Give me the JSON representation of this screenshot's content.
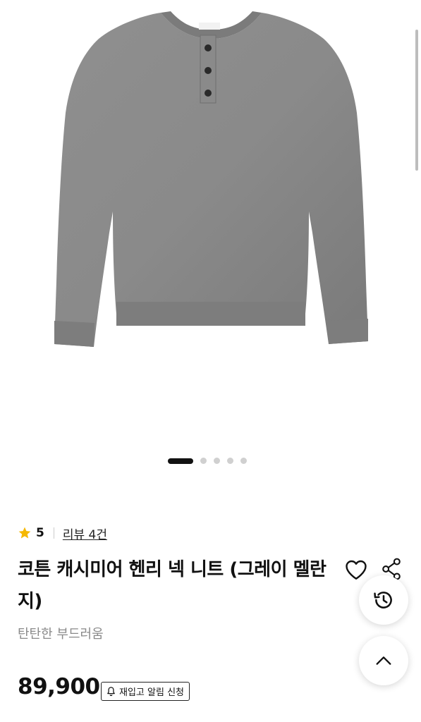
{
  "product": {
    "rating": "5",
    "review_link": "리뷰 4건",
    "title": "코튼 캐시미어 헨리 넥 니트 (그레이 멜란지)",
    "subtitle": "탄탄한 부드러움",
    "price": "89,900",
    "restock_label": "재입고 알림 신청"
  },
  "gallery": {
    "total_images": 5,
    "active_index": 0
  },
  "colors": {
    "star": "#f5b800",
    "sweater": "#8c8c8c",
    "text": "#111111",
    "subtext": "#8a8a8a"
  },
  "icons": [
    "star-icon",
    "heart-icon",
    "share-icon",
    "history-icon",
    "chevron-up-icon",
    "bell-icon"
  ]
}
